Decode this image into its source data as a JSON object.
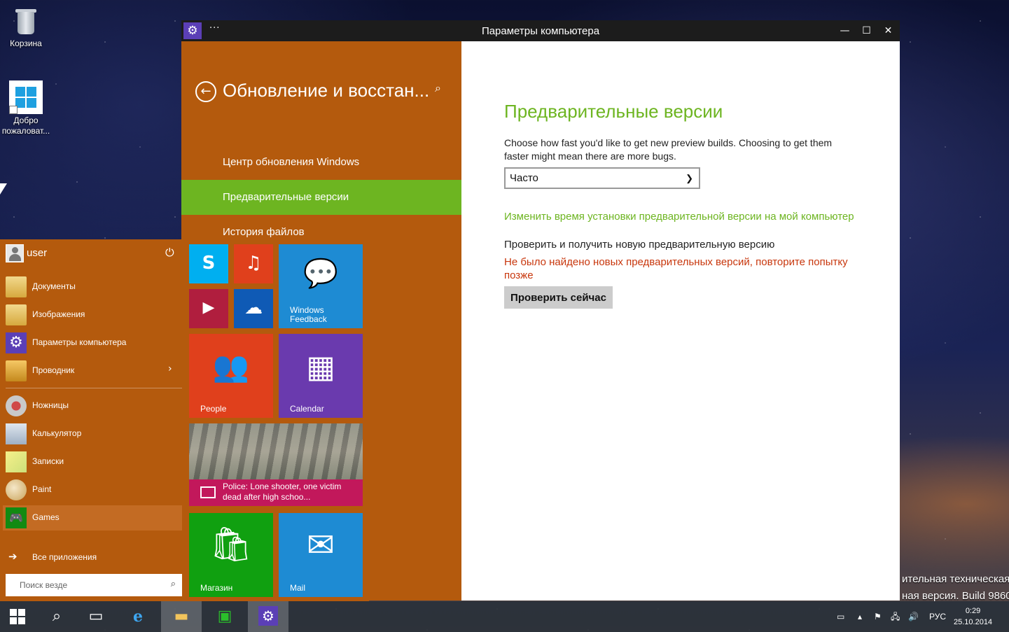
{
  "desktop": {
    "recycle_bin_label": "Корзина",
    "welcome_label": "Добро пожаловат...",
    "watermark_line1": "ительная техническая",
    "watermark_line2": "ная версия. Build 9860"
  },
  "window": {
    "title": "Параметры компьютера",
    "menu_dots": "···",
    "minimize": "—",
    "maximize": "☐",
    "close": "✕"
  },
  "settings_nav": {
    "section_title": "Обновление и восстан...",
    "items": [
      {
        "label": "Центр обновления Windows",
        "active": false
      },
      {
        "label": "Предварительные версии",
        "active": true
      },
      {
        "label": "История файлов",
        "active": false
      }
    ]
  },
  "settings_content": {
    "title": "Предварительные версии",
    "description": "Choose how fast you'd like to get new preview builds. Choosing to get them faster might mean there are more bugs.",
    "dropdown_value": "Часто",
    "change_time_link": "Изменить время установки предварительной версии на мой компьютер",
    "check_label": "Проверить и получить новую предварительную версию",
    "error_text": "Не было найдено новых предварительных версий, повторите попытку позже",
    "check_button": "Проверить сейчас"
  },
  "start_menu": {
    "user_name": "user",
    "items": [
      {
        "label": "Документы",
        "icon": "documents-folder-icon"
      },
      {
        "label": "Изображения",
        "icon": "pictures-folder-icon"
      },
      {
        "label": "Параметры компьютера",
        "icon": "gear-icon"
      },
      {
        "label": "Проводник",
        "icon": "explorer-icon",
        "has_submenu": true
      },
      {
        "label": "Ножницы",
        "icon": "scissors-icon"
      },
      {
        "label": "Калькулятор",
        "icon": "calculator-icon"
      },
      {
        "label": "Записки",
        "icon": "sticky-notes-icon"
      },
      {
        "label": "Paint",
        "icon": "paint-icon"
      },
      {
        "label": "Games",
        "icon": "games-controller-icon"
      }
    ],
    "all_apps": "Все приложения",
    "search_placeholder": "Поиск везде",
    "tiles": {
      "windows_feedback_line1": "Windows",
      "windows_feedback_line2": "Feedback",
      "people": "People",
      "calendar": "Calendar",
      "news_headline": "Police: Lone shooter, one victim dead after high schoo...",
      "store": "Магазин",
      "mail": "Mail"
    },
    "tile_colors": {
      "skype": "#00aff0",
      "music": "#e0401c",
      "video": "#b01e3e",
      "onedrive": "#0f5ab5",
      "feedback": "#1e8bd3",
      "people": "#e0401c",
      "calendar": "#6a3aae",
      "news": "#c2185b",
      "store": "#10a010",
      "mail": "#1e8bd3"
    }
  },
  "taskbar": {
    "language": "РУС",
    "time": "0:29",
    "date": "25.10.2014"
  },
  "colors": {
    "accent_orange": "#b45a0d",
    "accent_green": "#6db521",
    "error_red": "#c8370d",
    "settings_purple": "#5b3fb6"
  }
}
